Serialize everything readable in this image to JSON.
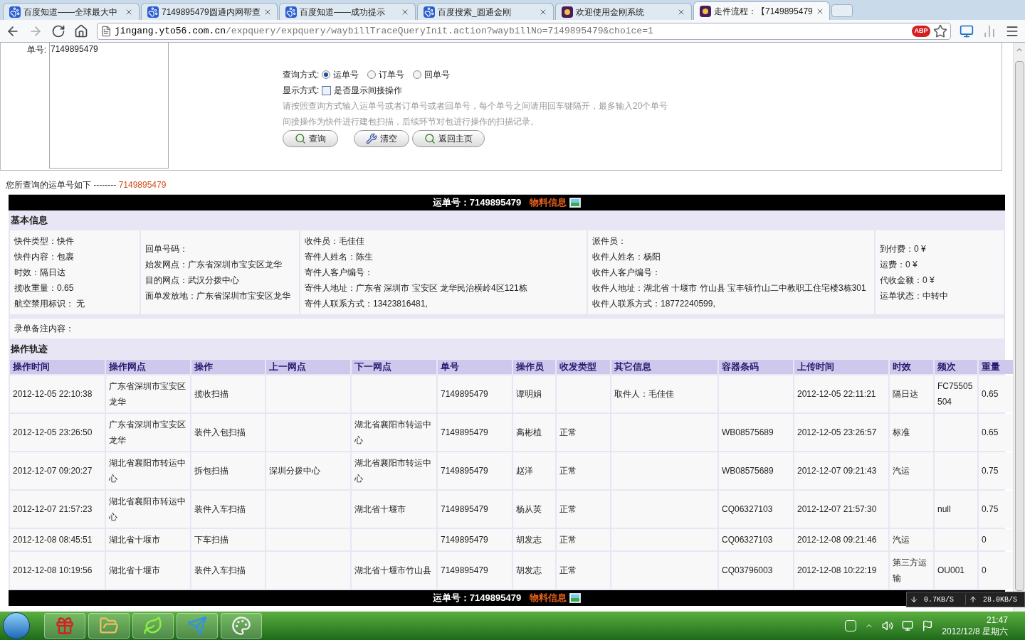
{
  "browser": {
    "tabs": [
      {
        "title": "百度知道——全球最大中",
        "kind": "paw",
        "selected": false
      },
      {
        "title": "7149895479圆通内网帮查",
        "kind": "paw",
        "selected": false
      },
      {
        "title": "百度知道——成功提示",
        "kind": "paw",
        "selected": false
      },
      {
        "title": "百度搜索_圆通金刚",
        "kind": "paw",
        "selected": false
      },
      {
        "title": "欢迎使用金刚系统",
        "kind": "yto",
        "selected": false
      },
      {
        "title": "走件流程：【7149895479",
        "kind": "yto",
        "selected": true
      }
    ],
    "address": {
      "host": "jingang.yto56.com.cn",
      "path": "/expquery/expquery/waybillTraceQueryInit.action?waybillNo=7149895479&choice=1"
    },
    "extension_badge": "ABP"
  },
  "query_form": {
    "number_label": "单号:",
    "number_value": "7149895479",
    "mode_label": "查询方式:",
    "modes": [
      {
        "label": "运单号",
        "selected": true
      },
      {
        "label": "订单号",
        "selected": false
      },
      {
        "label": "回单号",
        "selected": false
      }
    ],
    "display_label": "显示方式:",
    "indirect": {
      "label": "是否显示间接操作",
      "checked": false
    },
    "hints": [
      "请按照查询方式输入运单号或者订单号或者回单号，每个单号之间请用回车键隔开，最多输入20个单号",
      "间接操作为快件进行建包扫描，后续环节对包进行操作的扫描记录。"
    ],
    "buttons": [
      {
        "label": "查询",
        "kind": "search"
      },
      {
        "label": "清空",
        "kind": "clear"
      },
      {
        "label": "返回主页",
        "kind": "search"
      }
    ]
  },
  "result_caption": {
    "text": "您所查询的运单号如下 --------",
    "number": "7149895479"
  },
  "top_bar": {
    "waybill": "运单号：7149895479",
    "link": "物料信息"
  },
  "basic_info": {
    "title": "基本信息",
    "columns": [
      [
        "快件类型：快件",
        "快件内容：包裹",
        "时效：隔日达",
        "揽收重量：0.65",
        "航空禁用标识： 无"
      ],
      [
        "回单号码：",
        "始发网点：广东省深圳市宝安区龙华",
        "目的网点：武汉分拨中心",
        "面单发放地：广东省深圳市宝安区龙华"
      ],
      [
        "收件员：毛佳佳",
        "寄件人姓名：陈生",
        "寄件人客户编号：",
        "寄件人地址：广东省 深圳市 宝安区 龙华民治横岭4区121栋",
        "寄件人联系方式：13423816481,"
      ],
      [
        "派件员：",
        "收件人姓名：杨阳",
        "收件人客户编号：",
        "收件人地址：湖北省 十堰市 竹山县 宝丰镇竹山二中教职工住宅楼3栋301",
        "收件人联系方式：18772240599,"
      ],
      [
        "到付费：0 ¥",
        "运费：0 ¥",
        "代收金额：0 ¥",
        "运单状态：中转中"
      ]
    ],
    "remark": "录单备注内容："
  },
  "track": {
    "title": "操作轨迹",
    "columns": [
      "操作时间",
      "操作网点",
      "操作",
      "上一网点",
      "下一网点",
      "单号",
      "操作员",
      "收发类型",
      "其它信息",
      "容器条码",
      "上传时间",
      "时效",
      "频次",
      "重量"
    ],
    "rows": [
      [
        "2012-12-05 22:10:38",
        "广东省深圳市宝安区龙华",
        "揽收扫描",
        "",
        "",
        "7149895479",
        "谭明娟",
        "",
        "取件人：毛佳佳",
        "",
        "2012-12-05 22:11:21",
        "隔日达",
        "FC75505504",
        "0.65"
      ],
      [
        "2012-12-05 23:26:50",
        "广东省深圳市宝安区龙华",
        "装件入包扫描",
        "",
        "湖北省襄阳市转运中心",
        "7149895479",
        "高彬植",
        "正常",
        "",
        "WB08575689",
        "2012-12-05 23:26:57",
        "标准",
        "",
        "0.65"
      ],
      [
        "2012-12-07 09:20:27",
        "湖北省襄阳市转运中心",
        "拆包扫描",
        "深圳分拨中心",
        "湖北省襄阳市转运中心",
        "7149895479",
        "赵洋",
        "正常",
        "",
        "WB08575689",
        "2012-12-07 09:21:43",
        "汽运",
        "",
        "0.75"
      ],
      [
        "2012-12-07 21:57:23",
        "湖北省襄阳市转运中心",
        "装件入车扫描",
        "",
        "湖北省十堰市",
        "7149895479",
        "杨从英",
        "正常",
        "",
        "CQ06327103",
        "2012-12-07 21:57:30",
        "",
        "null",
        "0.75"
      ],
      [
        "2012-12-08 08:45:51",
        "湖北省十堰市",
        "下车扫描",
        "",
        "",
        "7149895479",
        "胡发志",
        "正常",
        "",
        "CQ06327103",
        "2012-12-08 09:21:46",
        "汽运",
        "",
        "0"
      ],
      [
        "2012-12-08 10:19:56",
        "湖北省十堰市",
        "装件入车扫描",
        "",
        "湖北省十堰市竹山县",
        "7149895479",
        "胡发志",
        "正常",
        "",
        "CQ03796003",
        "2012-12-08 10:22:19",
        "第三方运输",
        "OU001",
        "0"
      ]
    ]
  },
  "bottom_bar": {
    "waybill": "运单号：7149895479",
    "link": "物料信息"
  },
  "net_meter": {
    "down": "0.7KB/S",
    "up": "28.0KB/S"
  },
  "taskbar": {
    "apps": [
      {
        "kind": "gift"
      },
      {
        "kind": "folder"
      },
      {
        "kind": "leaf"
      },
      {
        "kind": "plane"
      },
      {
        "kind": "palette"
      }
    ],
    "time": "21:47",
    "date": "2012/12/8 星期六"
  }
}
